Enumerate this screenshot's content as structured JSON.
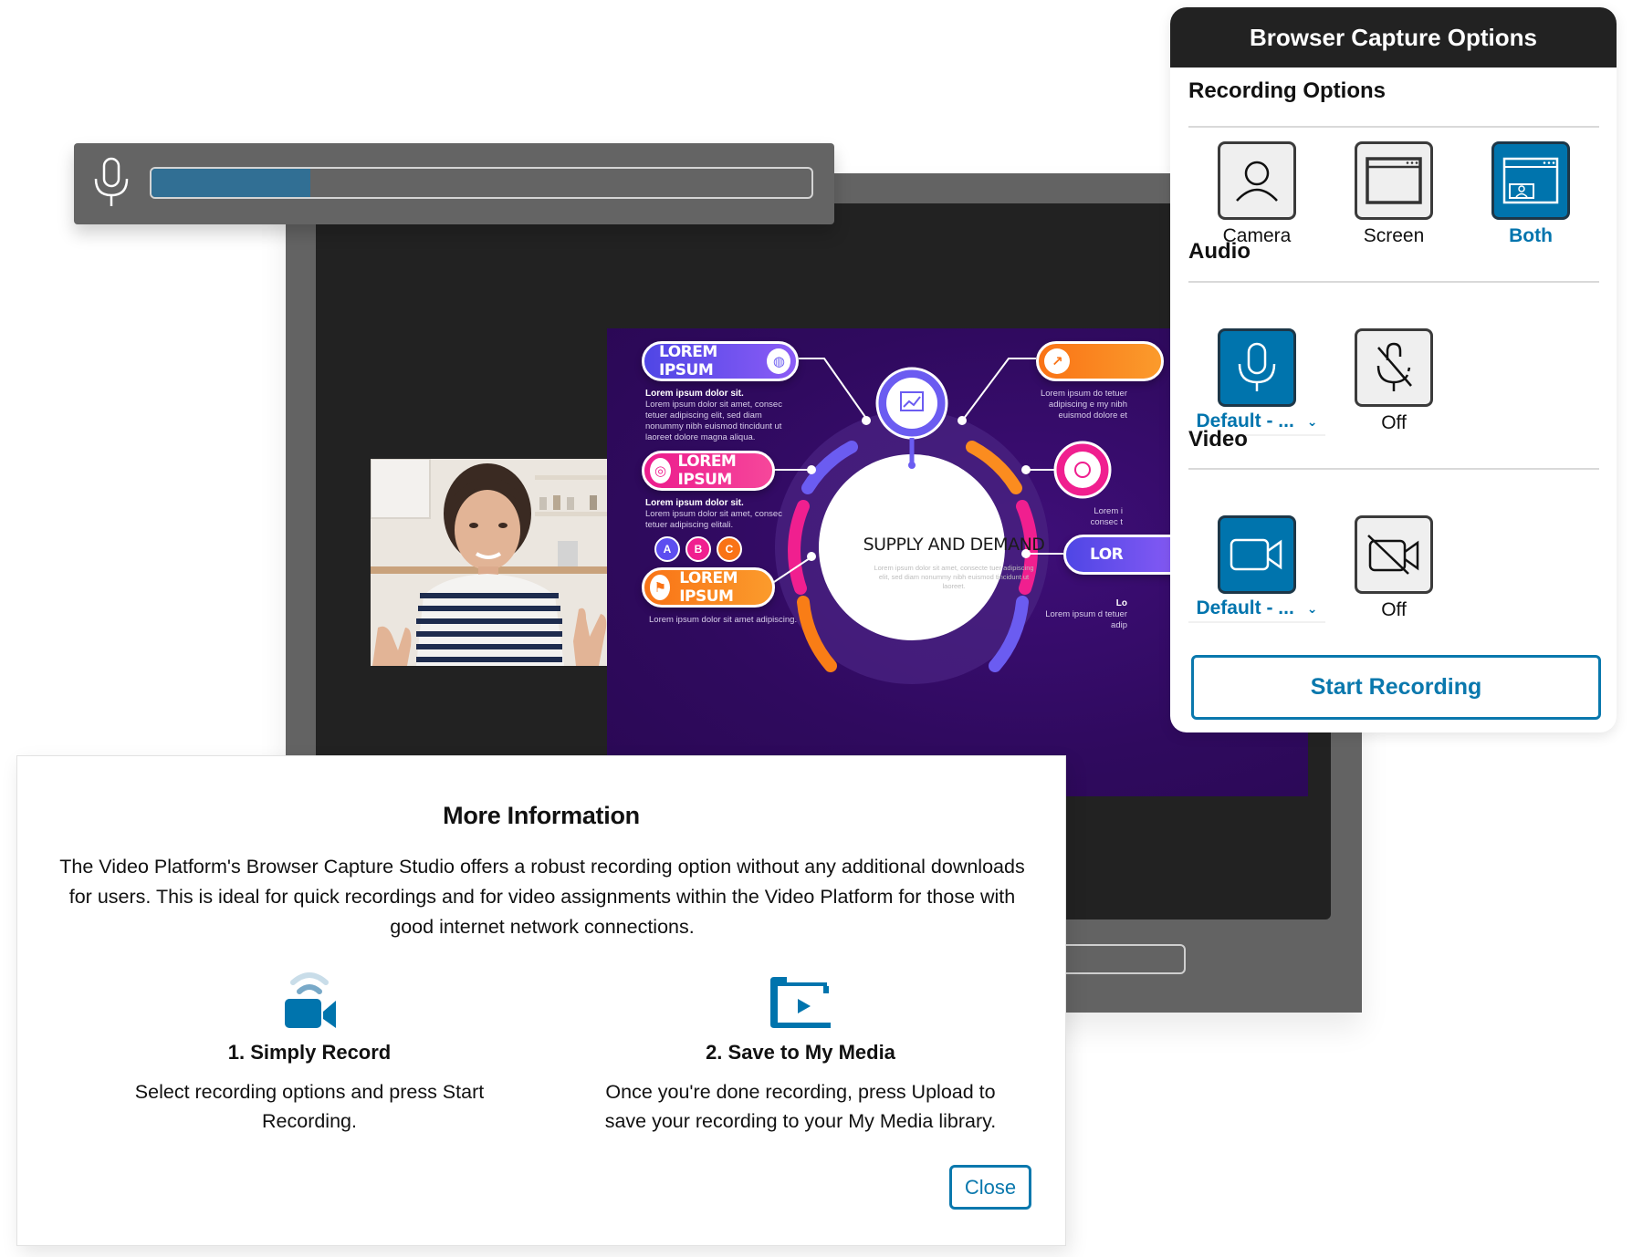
{
  "audio_meter": {
    "icon": "microphone-icon",
    "level": 0.24,
    "fill_color": "#316f94"
  },
  "slide": {
    "center_title": "SUPPLY AND DEMAND",
    "center_text": "Lorem ipsum dolor sit amet, consecte tuer adipiscing elit, sed diam nonummy nibh euismod tincidunt ut laoreet.",
    "pills": [
      {
        "label": "LOREM IPSUM",
        "icon": "globe-icon",
        "color": "purple"
      },
      {
        "label": "LOREM IPSUM",
        "icon": "target-icon",
        "color": "pink"
      },
      {
        "label": "LOREM IPSUM",
        "icon": "flag-icon",
        "color": "orange"
      },
      {
        "label": "",
        "icon": "chart-icon",
        "color": "orange"
      },
      {
        "label": "",
        "icon": "gear-icon",
        "color": "pink"
      },
      {
        "label": "LOR",
        "icon": "",
        "color": "purple"
      }
    ],
    "block1_heading": "Lorem ipsum dolor sit.",
    "block1_text": "Lorem ipsum dolor sit amet, consec tetuer adipiscing elit, sed diam nonummy nibh euismod tincidunt ut laoreet dolore magna aliqua.",
    "block2_heading": "Lorem ipsum dolor sit.",
    "block2_text": "Lorem ipsum dolor sit amet, consec tetuer adipiscing elitali.",
    "block3_text": "Lorem ipsum dolor sit amet adipiscing.",
    "right1_text": "Lorem ipsum do tetuer adipiscing e my nibh euismod dolore et",
    "right2_text": "Lorem i consec t",
    "right3_heading": "Lo",
    "right3_text": "Lorem ipsum d tetuer adip",
    "badges": [
      "A",
      "B",
      "C"
    ]
  },
  "panel": {
    "title": "Browser Capture Options",
    "recording_options": {
      "heading": "Recording Options",
      "options": [
        {
          "label": "Camera",
          "icon": "person-icon",
          "selected": false
        },
        {
          "label": "Screen",
          "icon": "window-icon",
          "selected": false
        },
        {
          "label": "Both",
          "icon": "window-with-camera-icon",
          "selected": true
        }
      ]
    },
    "audio": {
      "heading": "Audio",
      "device_label": "Default - ...",
      "off_label": "Off",
      "selected": "device"
    },
    "video": {
      "heading": "Video",
      "device_label": "Default - ...",
      "off_label": "Off",
      "selected": "device"
    },
    "start_button": "Start Recording",
    "accent_color": "#0074ad"
  },
  "dialog": {
    "title": "More Information",
    "body": "The Video Platform's Browser Capture Studio offers a robust recording option without any additional downloads for users. This is ideal for quick recordings and for video assignments within the Video Platform for those with good internet network connections.",
    "steps": [
      {
        "title": "1. Simply Record",
        "text": "Select recording options and press Start Recording.",
        "icon": "camera-broadcast-icon"
      },
      {
        "title": "2. Save to My Media",
        "text": "Once you're done recording, press Upload to save your recording to your My Media library.",
        "icon": "media-folder-icon"
      }
    ],
    "close_button": "Close"
  }
}
